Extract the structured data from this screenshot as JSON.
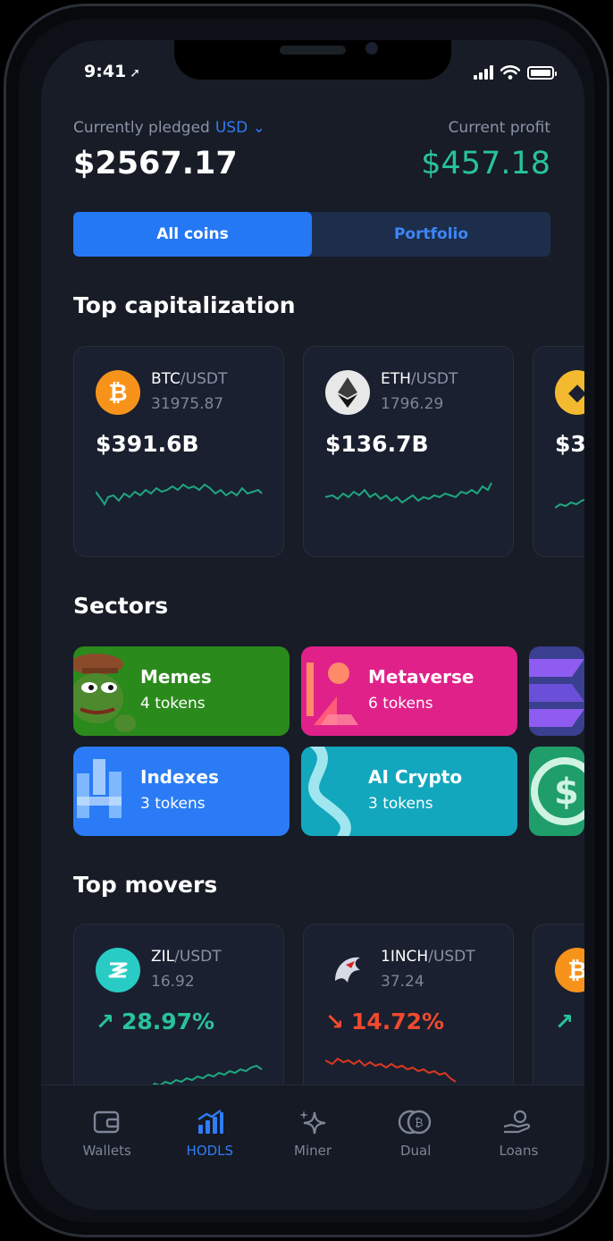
{
  "status_bar": {
    "time": "9:41"
  },
  "header": {
    "pledged_label": "Currently pledged",
    "currency": "USD",
    "pledged_value": "$2567.17",
    "profit_label": "Current profit",
    "profit_value": "$457.18"
  },
  "tabs": [
    {
      "label": "All coins",
      "active": true
    },
    {
      "label": "Portfolio",
      "active": false
    }
  ],
  "top_cap": {
    "title": "Top capitalization",
    "cards": [
      {
        "base": "BTC",
        "sep": "/",
        "quote": "USDT",
        "price": "31975.87",
        "value": "$391.6B",
        "logo": "bitcoin-icon"
      },
      {
        "base": "ETH",
        "sep": "/",
        "quote": "USDT",
        "price": "1796.29",
        "value": "$136.7B",
        "logo": "ethereum-icon"
      },
      {
        "base": "",
        "sep": "",
        "quote": "",
        "price": "",
        "value": "$3",
        "logo": "binance-icon"
      }
    ]
  },
  "sectors": {
    "title": "Sectors",
    "items": [
      {
        "name": "Memes",
        "count": "4 tokens",
        "color": "#2b8a1c"
      },
      {
        "name": "Metaverse",
        "count": "6 tokens",
        "color": "#e0218a"
      },
      {
        "name": "Indexes",
        "count": "3 tokens",
        "color": "#2a7bf5"
      },
      {
        "name": "AI Crypto",
        "count": "3 tokens",
        "color": "#12a7bd"
      }
    ]
  },
  "top_movers": {
    "title": "Top movers",
    "cards": [
      {
        "base": "ZIL",
        "sep": "/",
        "quote": "USDT",
        "price": "16.92",
        "change": "28.97%",
        "direction": "up",
        "logo": "zilliqa-icon"
      },
      {
        "base": "1INCH",
        "sep": "/",
        "quote": "USDT",
        "price": "37.24",
        "change": "14.72%",
        "direction": "down",
        "logo": "1inch-icon"
      }
    ]
  },
  "nav": [
    {
      "label": "Wallets",
      "icon": "wallet-icon",
      "active": false
    },
    {
      "label": "HODLS",
      "icon": "chart-bars-icon",
      "active": true
    },
    {
      "label": "Miner",
      "icon": "sparkle-icon",
      "active": false
    },
    {
      "label": "Dual",
      "icon": "coins-icon",
      "active": false
    },
    {
      "label": "Loans",
      "icon": "hand-coin-icon",
      "active": false
    }
  ],
  "colors": {
    "accent": "#2578f4",
    "positive": "#28c39a",
    "negative": "#f04a2e",
    "background": "#171c26"
  }
}
